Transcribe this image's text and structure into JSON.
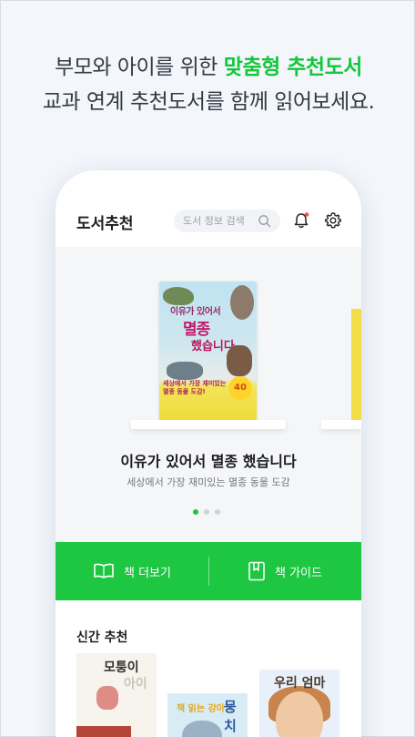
{
  "promo": {
    "line1_prefix": "부모와 아이를 위한 ",
    "line1_highlight": "맞춤형 추천도서",
    "line2": "교과 연계 추천도서를 함께 읽어보세요."
  },
  "app": {
    "title": "도서추천",
    "search_placeholder": "도서 정보 검색"
  },
  "featured": {
    "cover_title_top": "이유가 있어서",
    "cover_title_main": "멸종",
    "cover_title_end": "했습니다",
    "cover_band_line1": "세상에서 가장 재미있는",
    "cover_band_line2": "멸종 동물 도감!",
    "cover_badge": "40",
    "title": "이유가 있어서 멸종 했습니다",
    "subtitle": "세상에서 가장 재미있는 멸종 동물 도감",
    "page_count": 3,
    "active_page": 1
  },
  "actions": {
    "more_books": "책 더보기",
    "book_guide": "책 가이드"
  },
  "new_section": {
    "title": "신간 추천",
    "books": [
      {
        "cover_title": "모퉁이",
        "cover_title_sub": "아이"
      },
      {
        "cover_title": "책 읽는 강아지",
        "cover_title_sub": "뭉치"
      },
      {
        "cover_title": "우리 엄마"
      }
    ]
  },
  "colors": {
    "accent": "#1ec742",
    "highlight_text": "#14c73c",
    "notification_dot": "#ff4a4a"
  }
}
